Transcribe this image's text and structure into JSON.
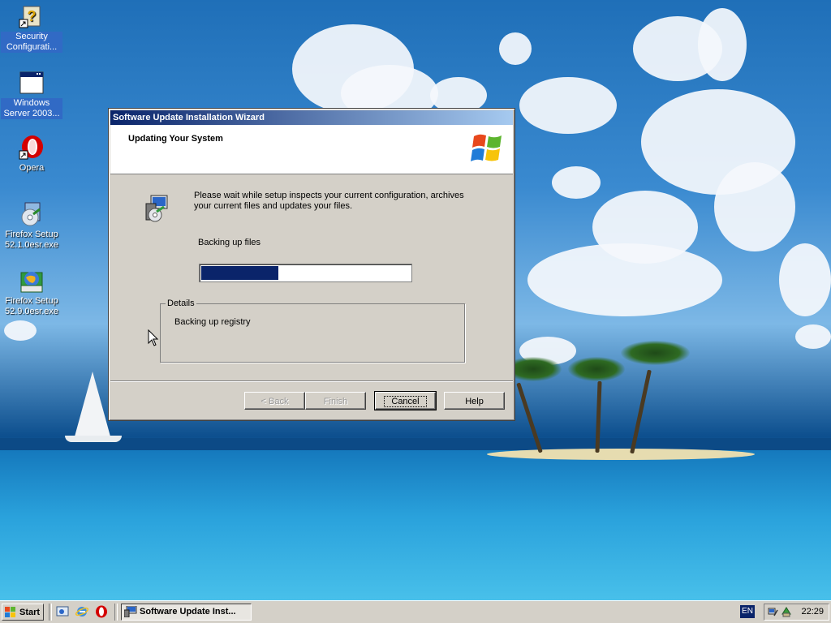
{
  "desktop": {
    "icons": [
      {
        "label": "Security Configurati...",
        "icon": "security-config-icon"
      },
      {
        "label": "Windows Server 2003...",
        "icon": "window-shortcut-icon"
      },
      {
        "label": "Opera",
        "icon": "opera-icon"
      },
      {
        "label": "Firefox Setup 52.1.0esr.exe",
        "icon": "installer-cd-icon"
      },
      {
        "label": "Firefox Setup 52.9.0esr.exe",
        "icon": "installer-globe-icon"
      }
    ]
  },
  "dialog": {
    "title": "Software Update Installation Wizard",
    "header_title": "Updating Your System",
    "intro_text": "Please wait while setup inspects your current configuration, archives your current files and updates your files.",
    "status_text": "Backing up files",
    "progress_fraction": 0.37,
    "details_legend": "Details",
    "details_text": "Backing up registry",
    "buttons": {
      "back": "< Back",
      "finish": "Finish",
      "cancel": "Cancel",
      "help": "Help"
    }
  },
  "taskbar": {
    "start_label": "Start",
    "quick_launch": [
      "show-desktop-icon",
      "internet-explorer-icon",
      "opera-icon"
    ],
    "task_button_label": "Software Update Inst...",
    "language": "EN",
    "clock": "22:29"
  },
  "colors": {
    "titlebar_start": "#0a246a",
    "titlebar_end": "#a6caf0",
    "progress_fill": "#0a246a",
    "dialog_face": "#d4d0c8"
  }
}
